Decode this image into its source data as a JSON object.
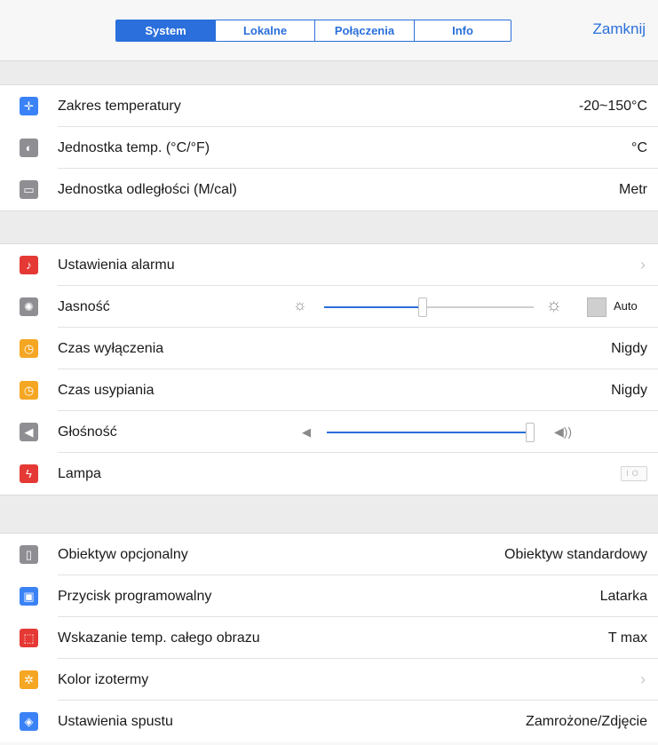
{
  "header": {
    "tabs": [
      {
        "label": "System",
        "active": true
      },
      {
        "label": "Lokalne",
        "active": false
      },
      {
        "label": "Połączenia",
        "active": false
      },
      {
        "label": "Info",
        "active": false
      }
    ],
    "close_label": "Zamknij"
  },
  "colors": {
    "accent": "#2a6fdb"
  },
  "group1": [
    {
      "label": "Zakres temperatury",
      "value": "-20~150°C",
      "icon": "crosshair-icon",
      "icon_color": "#3b82f6"
    },
    {
      "label": "Jednostka temp. (°C/°F)",
      "value": "°C",
      "icon": "thermometer-icon",
      "icon_color": "#8e8e93"
    },
    {
      "label": "Jednostka odległości (M/cal)",
      "value": "Metr",
      "icon": "ruler-icon",
      "icon_color": "#8e8e93"
    }
  ],
  "group2": {
    "alarm": {
      "label": "Ustawienia alarmu",
      "icon": "alarm-icon",
      "icon_color": "#e53935"
    },
    "brightness": {
      "label": "Jasność",
      "icon": "brightness-icon",
      "icon_color": "#8e8e93",
      "level": 0.47,
      "auto_label": "Auto"
    },
    "shutdown": {
      "label": "Czas wyłączenia",
      "value": "Nigdy",
      "icon": "timer-icon",
      "icon_color": "#f5a623"
    },
    "sleep": {
      "label": "Czas usypiania",
      "value": "Nigdy",
      "icon": "sleep-icon",
      "icon_color": "#f5a623"
    },
    "volume": {
      "label": "Głośność",
      "icon": "speaker-icon",
      "icon_color": "#8e8e93",
      "level": 1.0
    },
    "lamp": {
      "label": "Lampa",
      "icon": "flash-icon",
      "icon_color": "#e53935",
      "on": false
    }
  },
  "group3": [
    {
      "label": "Obiektyw opcjonalny",
      "value": "Obiektyw standardowy",
      "icon": "lens-icon",
      "icon_color": "#8e8e93"
    },
    {
      "label": "Przycisk programowalny",
      "value": "Latarka",
      "icon": "button-icon",
      "icon_color": "#3b82f6"
    },
    {
      "label": "Wskazanie temp. całego obrazu",
      "value": "T max",
      "icon": "image-temp-icon",
      "icon_color": "#e53935"
    },
    {
      "label": "Kolor izotermy",
      "value": "",
      "icon": "isotherm-icon",
      "icon_color": "#f5a623",
      "chevron": true
    },
    {
      "label": "Ustawienia spustu",
      "value": "Zamrożone/Zdjęcie",
      "icon": "trigger-icon",
      "icon_color": "#3b82f6"
    }
  ]
}
